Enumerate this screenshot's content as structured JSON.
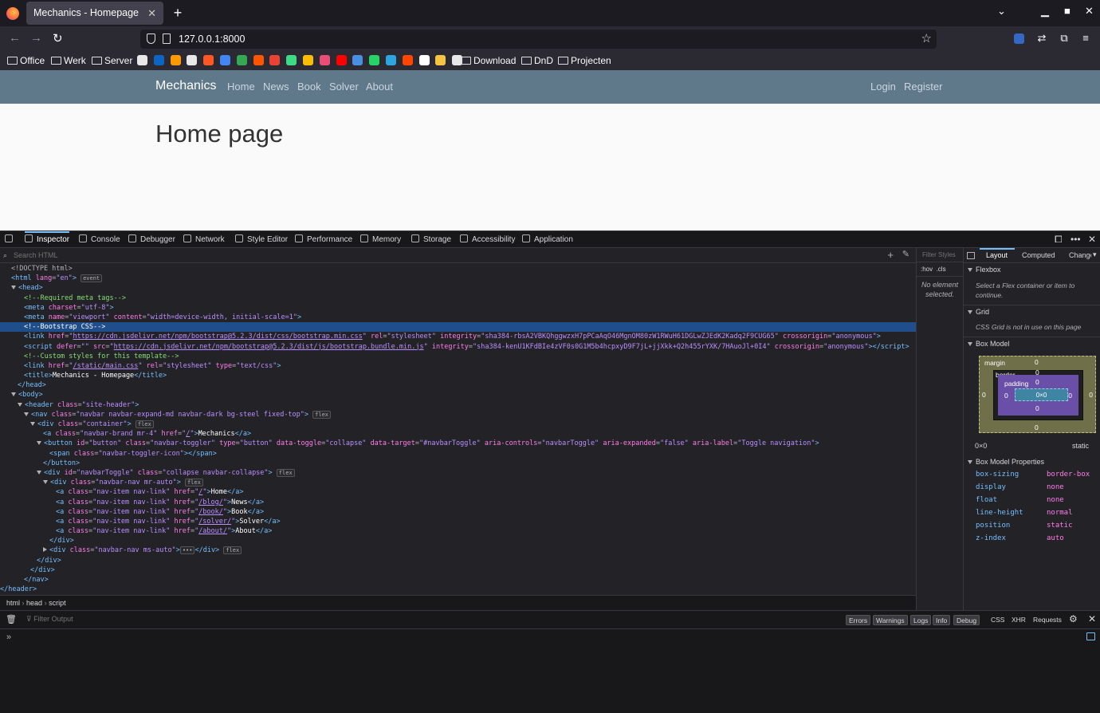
{
  "browser": {
    "tab_title": "Mechanics - Homepage",
    "url": "127.0.0.1:8000",
    "bookmarks": [
      "Office",
      "Werk",
      "Server",
      "Download",
      "DnD",
      "Projecten"
    ],
    "bookmark_icon_colors": [
      "#e8e8e8",
      "#0a66c2",
      "#ff9900",
      "#e8e8e8",
      "#ff5722",
      "#4285f4",
      "#34a853",
      "#ff5500",
      "#ea4335",
      "#3ddc84",
      "#fbbc05",
      "#e94e77",
      "#ff0000",
      "#4a90e2",
      "#25d366",
      "#2ca5e0",
      "#ff4500",
      "#ffffff",
      "#f5c542",
      "#e8e8e8"
    ]
  },
  "site": {
    "brand": "Mechanics",
    "nav": [
      "Home",
      "News",
      "Book",
      "Solver",
      "About"
    ],
    "right_nav": [
      "Login",
      "Register"
    ],
    "heading": "Home page"
  },
  "devtools": {
    "tabs": [
      "Inspector",
      "Console",
      "Debugger",
      "Network",
      "Style Editor",
      "Performance",
      "Memory",
      "Storage",
      "Accessibility",
      "Application"
    ],
    "search_placeholder": "Search HTML",
    "breadcrumbs": [
      "html",
      "head",
      "script"
    ],
    "filter_styles": "Filter Styles",
    "hov": ":hov",
    "cls": ".cls",
    "no_element": "No element selected.",
    "side_tabs": [
      "Layout",
      "Computed",
      "Changes"
    ],
    "flexbox_title": "Flexbox",
    "flexbox_hint": "Select a Flex container or item to continue.",
    "grid_title": "Grid",
    "grid_hint": "CSS Grid is not in use on this page",
    "boxmodel_title": "Box Model",
    "box": {
      "margin": "margin",
      "border": "border",
      "padding": "padding",
      "content": "0×0",
      "zero": "0",
      "size": "0×0",
      "position": "static"
    },
    "props_title": "Box Model Properties",
    "props": [
      [
        "box-sizing",
        "border-box"
      ],
      [
        "display",
        "none"
      ],
      [
        "float",
        "none"
      ],
      [
        "line-height",
        "normal"
      ],
      [
        "position",
        "static"
      ],
      [
        "z-index",
        "auto"
      ]
    ],
    "console": {
      "filter": "Filter Output",
      "levels": [
        "Errors",
        "Warnings",
        "Logs",
        "Info",
        "Debug"
      ],
      "extra": [
        "CSS",
        "XHR",
        "Requests"
      ]
    }
  },
  "html_tree": [
    "&lt;!DOCTYPE html&gt;",
    "<span class='tg'>&lt;html</span> <span class='at'>lang</span>=<span class='av'>\"en\"</span><span class='tg'>&gt;</span> <span class='bdg'>event</span>",
    "<span class='tw'></span><span class='tg'>&lt;head&gt;</span>",
    "<span class='cm'>&lt;!--Required meta tags--&gt;</span>",
    "<span class='tg'>&lt;meta</span> <span class='at'>charset</span>=<span class='av'>\"utf-8\"</span><span class='tg'>&gt;</span>",
    "<span class='tg'>&lt;meta</span> <span class='at'>name</span>=<span class='av'>\"viewport\"</span> <span class='at'>content</span>=<span class='av'>\"width=device-width, initial-scale=1\"</span><span class='tg'>&gt;</span>",
    "&lt;!--Bootstrap CSS--&gt;",
    "<span class='tg'>&lt;link</span> <span class='at'>href</span>=<span class='av'>\"<span class='lk'>https://cdn.jsdelivr.net/npm/bootstrap@5.2.3/dist/css/bootstrap.min.css</span>\"</span> <span class='at'>rel</span>=<span class='av'>\"stylesheet\"</span> <span class='at'>integrity</span>=<span class='av'>\"sha384-rbsA2VBKQhggwzxH7pPCaAqO46MgnOM80zW1RWuH61DGLwZJEdK2Kadq2F9CUG65\"</span> <span class='at'>crossorigin</span>=<span class='av'>\"anonymous\"</span><span class='tg'>&gt;</span>",
    "<span class='tg'>&lt;script</span> <span class='at'>defer</span>=<span class='av'>\"\"</span> <span class='at'>src</span>=<span class='av'>\"<span class='lk'>https://cdn.jsdelivr.net/npm/bootstrap@5.2.3/dist/js/bootstrap.bundle.min.js</span>\"</span> <span class='at'>integrity</span>=<span class='av'>\"sha384-kenU1KFdBIe4zVF0s0G1M5b4hcpxyD9F7jL+jjXkk+Q2h455rYXK/7HAuoJl+0I4\"</span> <span class='at'>crossorigin</span>=<span class='av'>\"anonymous\"</span><span class='tg'>&gt;&lt;/script&gt;</span>",
    "<span class='cm'>&lt;!--Custom styles for this template--&gt;</span>",
    "<span class='tg'>&lt;link</span> <span class='at'>href</span>=<span class='av'>\"<span class='lk'>/static/main.css</span>\"</span> <span class='at'>rel</span>=<span class='av'>\"stylesheet\"</span> <span class='at'>type</span>=<span class='av'>\"text/css\"</span><span class='tg'>&gt;</span>",
    "<span class='tg'>&lt;title&gt;</span><span style='color:#fff'>Mechanics - Homepage</span><span class='tg'>&lt;/title&gt;</span>",
    "<span class='tg'>&lt;/head&gt;</span>",
    "<span class='tw'></span><span class='tg'>&lt;body&gt;</span>",
    "<span class='tw'></span><span class='tg'>&lt;header</span> <span class='at'>class</span>=<span class='av'>\"site-header\"</span><span class='tg'>&gt;</span>",
    "<span class='tw'></span><span class='tg'>&lt;nav</span> <span class='at'>class</span>=<span class='av'>\"navbar navbar-expand-md navbar-dark bg-steel fixed-top\"</span><span class='tg'>&gt;</span> <span class='bdg'>flex</span>",
    "<span class='tw'></span><span class='tg'>&lt;div</span> <span class='at'>class</span>=<span class='av'>\"container\"</span><span class='tg'>&gt;</span> <span class='bdg'>flex</span>",
    "<span class='tg'>&lt;a</span> <span class='at'>class</span>=<span class='av'>\"navbar-brand mr-4\"</span> <span class='at'>href</span>=<span class='av'>\"<span class='lk'>/</span>\"</span><span class='tg'>&gt;</span><span style='color:#fff'>Mechanics</span><span class='tg'>&lt;/a&gt;</span>",
    "<span class='tw'></span><span class='tg'>&lt;button</span> <span class='at'>id</span>=<span class='av'>\"button\"</span> <span class='at'>class</span>=<span class='av'>\"navbar-toggler\"</span> <span class='at'>type</span>=<span class='av'>\"button\"</span> <span class='at'>data-toggle</span>=<span class='av'>\"collapse\"</span> <span class='at'>data-target</span>=<span class='av'>\"#navbarToggle\"</span> <span class='at'>aria-controls</span>=<span class='av'>\"navbarToggle\"</span> <span class='at'>aria-expanded</span>=<span class='av'>\"false\"</span> <span class='at'>aria-label</span>=<span class='av'>\"Toggle navigation\"</span><span class='tg'>&gt;</span>",
    "<span class='tg'>&lt;span</span> <span class='at'>class</span>=<span class='av'>\"navbar-toggler-icon\"</span><span class='tg'>&gt;&lt;/span&gt;</span>",
    "<span class='tg'>&lt;/button&gt;</span>",
    "<span class='tw'></span><span class='tg'>&lt;div</span> <span class='at'>id</span>=<span class='av'>\"navbarToggle\"</span> <span class='at'>class</span>=<span class='av'>\"collapse navbar-collapse\"</span><span class='tg'>&gt;</span> <span class='bdg'>flex</span>",
    "<span class='tw'></span><span class='tg'>&lt;div</span> <span class='at'>class</span>=<span class='av'>\"navbar-nav mr-auto\"</span><span class='tg'>&gt;</span> <span class='bdg'>flex</span>",
    "<span class='tg'>&lt;a</span> <span class='at'>class</span>=<span class='av'>\"nav-item nav-link\"</span> <span class='at'>href</span>=<span class='av'>\"<span class='lk'>/</span>\"</span><span class='tg'>&gt;</span><span style='color:#fff'>Home</span><span class='tg'>&lt;/a&gt;</span>",
    "<span class='tg'>&lt;a</span> <span class='at'>class</span>=<span class='av'>\"nav-item nav-link\"</span> <span class='at'>href</span>=<span class='av'>\"<span class='lk'>/blog/</span>\"</span><span class='tg'>&gt;</span><span style='color:#fff'>News</span><span class='tg'>&lt;/a&gt;</span>",
    "<span class='tg'>&lt;a</span> <span class='at'>class</span>=<span class='av'>\"nav-item nav-link\"</span> <span class='at'>href</span>=<span class='av'>\"<span class='lk'>/book/</span>\"</span><span class='tg'>&gt;</span><span style='color:#fff'>Book</span><span class='tg'>&lt;/a&gt;</span>",
    "<span class='tg'>&lt;a</span> <span class='at'>class</span>=<span class='av'>\"nav-item nav-link\"</span> <span class='at'>href</span>=<span class='av'>\"<span class='lk'>/solver/</span>\"</span><span class='tg'>&gt;</span><span style='color:#fff'>Solver</span><span class='tg'>&lt;/a&gt;</span>",
    "<span class='tg'>&lt;a</span> <span class='at'>class</span>=<span class='av'>\"nav-item nav-link\"</span> <span class='at'>href</span>=<span class='av'>\"<span class='lk'>/about/</span>\"</span><span class='tg'>&gt;</span><span style='color:#fff'>About</span><span class='tg'>&lt;/a&gt;</span>",
    "<span class='tg'>&lt;/div&gt;</span>",
    "<span class='twr'></span><span class='tg'>&lt;div</span> <span class='at'>class</span>=<span class='av'>\"navbar-nav ms-auto\"</span><span class='tg'>&gt;</span><span class='bdg'>•••</span><span class='tg'>&lt;/div&gt;</span> <span class='bdg'>flex</span>",
    "<span class='tg'>&lt;/div&gt;</span>",
    "<span class='tg'>&lt;/div&gt;</span>",
    "<span class='tg'>&lt;/nav&gt;</span>",
    "<span class='tg'>&lt;/header&gt;</span>"
  ]
}
